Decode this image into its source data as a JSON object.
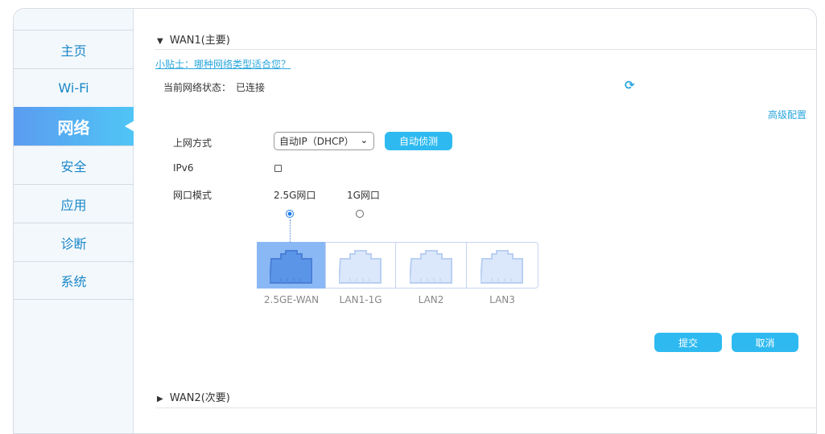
{
  "sidebar": {
    "items": [
      {
        "label": "主页"
      },
      {
        "label": "Wi-Fi"
      },
      {
        "label": "网络",
        "active": true
      },
      {
        "label": "安全"
      },
      {
        "label": "应用"
      },
      {
        "label": "诊断"
      },
      {
        "label": "系统"
      }
    ]
  },
  "wan1": {
    "title": "WAN1(主要)",
    "tip": "小贴士：哪种网络类型适合您？",
    "status_label": "当前网络状态：",
    "status_value": "已连接",
    "advanced": "高级配置",
    "conn_label": "上网方式",
    "conn_value": "自动IP（DHCP）",
    "detect": "自动侦测",
    "ipv6_label": "IPv6",
    "ipv6_checked": false,
    "port_mode_label": "网口模式",
    "modes": [
      "2.5G网口",
      "1G网口"
    ],
    "selected_mode": 0,
    "ports": [
      "2.5GE-WAN",
      "LAN1-1G",
      "LAN2",
      "LAN3"
    ],
    "submit": "提交",
    "cancel": "取消"
  },
  "wan2": {
    "title": "WAN2(次要)"
  },
  "colors": {
    "accent": "#2ebaf0",
    "link": "#29a6dc",
    "active_port": "#8ab8f5"
  }
}
